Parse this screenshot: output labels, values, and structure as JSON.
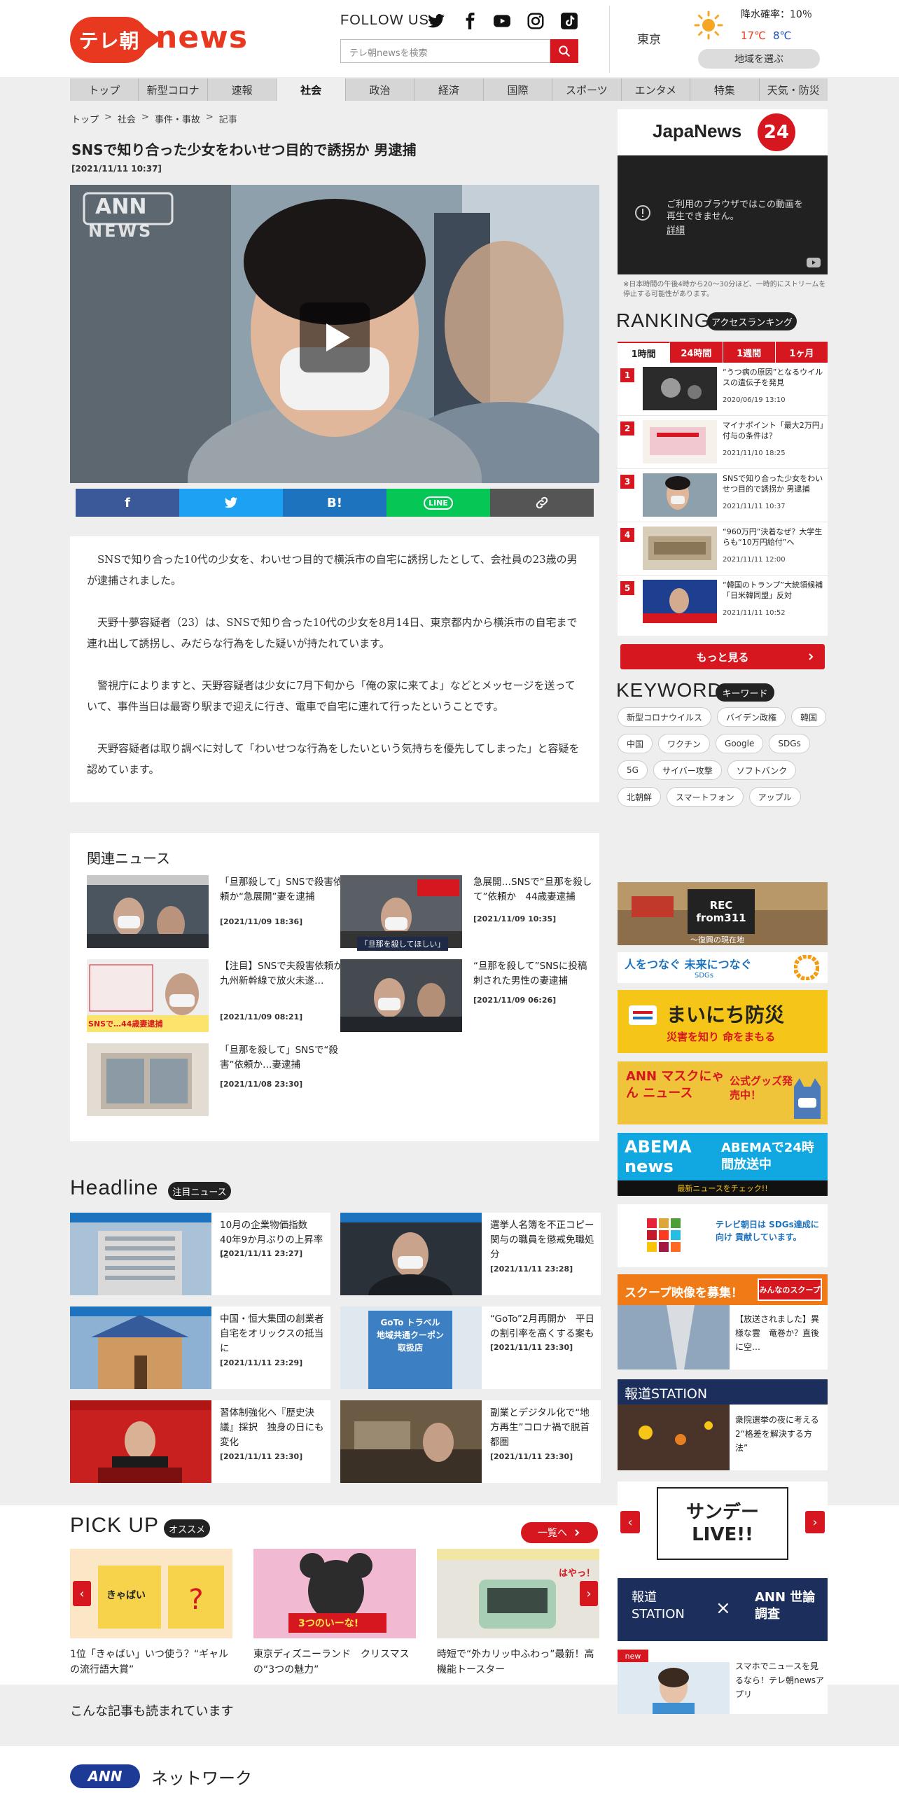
{
  "header": {
    "logo_pill": "テレ朝",
    "logo_news": "news",
    "follow_us": "FOLLOW US",
    "search_placeholder": "テレ朝newsを検索",
    "weather": {
      "city": "東京",
      "rain": "降水確率：10％",
      "high": "17℃",
      "low": "8℃",
      "area_button": "地域を選ぶ"
    }
  },
  "nav": [
    "トップ",
    "新型コロナ",
    "速報",
    "社会",
    "政治",
    "経済",
    "国際",
    "スポーツ",
    "エンタメ",
    "特集",
    "天気・防災"
  ],
  "nav_active": "社会",
  "breadcrumb": [
    "トップ",
    "社会",
    "事件・事故",
    "記事"
  ],
  "article": {
    "title": "SNSで知り合った少女をわいせつ目的で誘拐か 男逮捕",
    "date": "[2021/11/11 10:37]",
    "video_watermark": "ANN",
    "video_watermark_sub": "NEWS",
    "share": [
      "f",
      "t",
      "B!",
      "LINE",
      "link"
    ],
    "paragraphs": [
      "SNSで知り合った10代の少女を、わいせつ目的で横浜市の自宅に誘拐したとして、会社員の23歳の男が逮捕されました。",
      "天野十夢容疑者（23）は、SNSで知り合った10代の少女を8月14日、東京都内から横浜市の自宅まで連れ出して誘拐し、みだらな行為をした疑いが持たれています。",
      "警視庁によりますと、天野容疑者は少女に7月下旬から「俺の家に来てよ」などとメッセージを送っていて、事件当日は最寄り駅まで迎えに行き、電車で自宅に連れて行ったということです。",
      "天野容疑者は取り調べに対して「わいせつな行為をしたいという気持ちを優先してしまった」と容疑を認めています。"
    ]
  },
  "related": {
    "heading": "関連ニュース",
    "items": [
      {
        "title": "「旦那殺して」SNSで殺害依頼か“急展開”妻を逮捕",
        "date": "[2021/11/09 18:36]"
      },
      {
        "title": "急展開…SNSで“旦那を殺して”依頼か　44歳妻逮捕",
        "date": "[2021/11/09 10:35]"
      },
      {
        "title": "【注目】SNSで夫殺害依頼か九州新幹線で放火未遂…",
        "date": "[2021/11/09 08:21]"
      },
      {
        "title": "“旦那を殺して”SNSに投稿 刺された男性の妻逮捕",
        "date": "[2021/11/09 06:26]"
      },
      {
        "title": "「旦那を殺して」SNSで“殺害”依頼か…妻逮捕",
        "date": "[2021/11/08 23:30]"
      }
    ],
    "thumb_caption": "「旦那を殺してほしい」",
    "thumb_badge": "SNSで…44歳妻逮捕"
  },
  "headline": {
    "heading": "Headline",
    "tag": "注目ニュース",
    "items": [
      {
        "title": "10月の企業物価指数　40年9か月ぶりの上昇率に",
        "date": "[2021/11/11 23:27]"
      },
      {
        "title": "選挙人名簿を不正コピー 関与の職員を懲戒免職処分",
        "date": "[2021/11/11 23:28]"
      },
      {
        "title": "中国・恒大集団の創業者自宅をオリックスの抵当に",
        "date": "[2021/11/11 23:29]"
      },
      {
        "title": "“GoTo”2月再開か　平日の割引率を高くする案も",
        "date": "[2021/11/11 23:30]"
      },
      {
        "title": "習体制強化へ『歴史決議』採択　独身の日にも変化",
        "date": "[2021/11/11 23:30]"
      },
      {
        "title": "副業とデジタル化で“地方再生”コロナ禍で脱首都圏",
        "date": "[2021/11/11 23:30]"
      }
    ],
    "thumb_text_goto": "GoTo トラベル 地域共通クーポン取扱店"
  },
  "pickup": {
    "heading": "PICK UP",
    "tag": "オススメ",
    "more": "一覧へ",
    "items": [
      {
        "title": "1位「きゃばい」いつ使う？“ギャルの流行語大賞”",
        "thumb_text": "きゃばい"
      },
      {
        "title": "東京ディズニーランド　クリスマスの“3つの魅力”",
        "thumb_text": "3つのいーな!"
      },
      {
        "title": "時短で“外カリッ中ふわっ”最新！高機能トースター",
        "thumb_text": "はやっ！"
      }
    ]
  },
  "also_read": "こんな記事も読まれています",
  "ann_network": {
    "logo": "ANN",
    "label": "ネットワーク"
  },
  "sidebar": {
    "japanews_text": "JapaNews",
    "japanews_num": "24",
    "video_error": "ご利用のブラウザではこの動画を再生できません。",
    "video_error_link": "詳細",
    "stream_note": "※日本時間の午後4時から20～30分ほど、一時的にストリームを停止する可能性があります。",
    "ranking_heading": "RANKING",
    "ranking_tag": "アクセスランキング",
    "ranking_tabs": [
      "1時間",
      "24時間",
      "1週間",
      "1ヶ月"
    ],
    "ranking": [
      {
        "num": "1",
        "title": "“うつ病の原因”となるウイルスの遺伝子を発見",
        "date": "2020/06/19 13:10"
      },
      {
        "num": "2",
        "title": "マイナポイント「最大2万円」　付与の条件は？",
        "date": "2021/11/10 18:25"
      },
      {
        "num": "3",
        "title": "SNSで知り合った少女をわいせつ目的で誘拐か 男逮捕",
        "date": "2021/11/11 10:37"
      },
      {
        "num": "4",
        "title": "“960万円”決着なぜ？大学生らも“10万円給付”へ",
        "date": "2021/11/11 12:00"
      },
      {
        "num": "5",
        "title": "“韓国のトランプ”大統領候補 「日米韓同盟」反対",
        "date": "2021/11/11 10:52"
      }
    ],
    "ranking_more": "もっと見る",
    "keyword_heading": "KEYWORD",
    "keyword_tag": "キーワード",
    "keywords": [
      "新型コロナウイルス",
      "バイデン政権",
      "韓国",
      "中国",
      "ワクチン",
      "Google",
      "SDGs",
      "5G",
      "サイバー攻撃",
      "ソフトバンク",
      "北朝鮮",
      "スマートフォン",
      "アップル"
    ],
    "banners": {
      "rec311": "REC from311",
      "rec311_sub": "～復興の現在地",
      "sdgs": "人をつなぐ 未来につなぐ",
      "sdgs_sub": "SDGs",
      "bousai": "まいにち防災",
      "bousai_sub": "災害を知り 命をまもる",
      "mask": "ANN マスクにゃん ニュース",
      "mask_badge": "公式グッズ発売中！",
      "abema_logo": "ABEMA news",
      "abema_text": "ABEMAで24時間放送中",
      "abema_sub": "最新ニュースをチェック!!",
      "sdgs2_text": "テレビ朝日は SDGs達成に向け 貢献しています。",
      "scoop_head": "スクープ映像を募集！",
      "scoop_badge": "みんなのスクープ",
      "scoop_text": "【放送されました】異様な雲　竜巻か？直後に空…",
      "houdou_head": "報道STATION",
      "houdou_text": "衆院選挙の夜に考える2“格差を解決する方法”",
      "sunday_live": "サンデーLIVE!!",
      "houdou2": "報道 STATION",
      "ann_poll": "ANN 世論調査",
      "app_text": "スマホでニュースを見るなら！テレ朝newsアプリ",
      "app_badge": "new"
    }
  },
  "colors": {
    "brand_red": "#d7171f",
    "logo_red": "#e8381f",
    "fb": "#3b5998",
    "tw": "#1da1f2",
    "hatena": "#1e73be",
    "line": "#06c755",
    "link": "#555555"
  }
}
